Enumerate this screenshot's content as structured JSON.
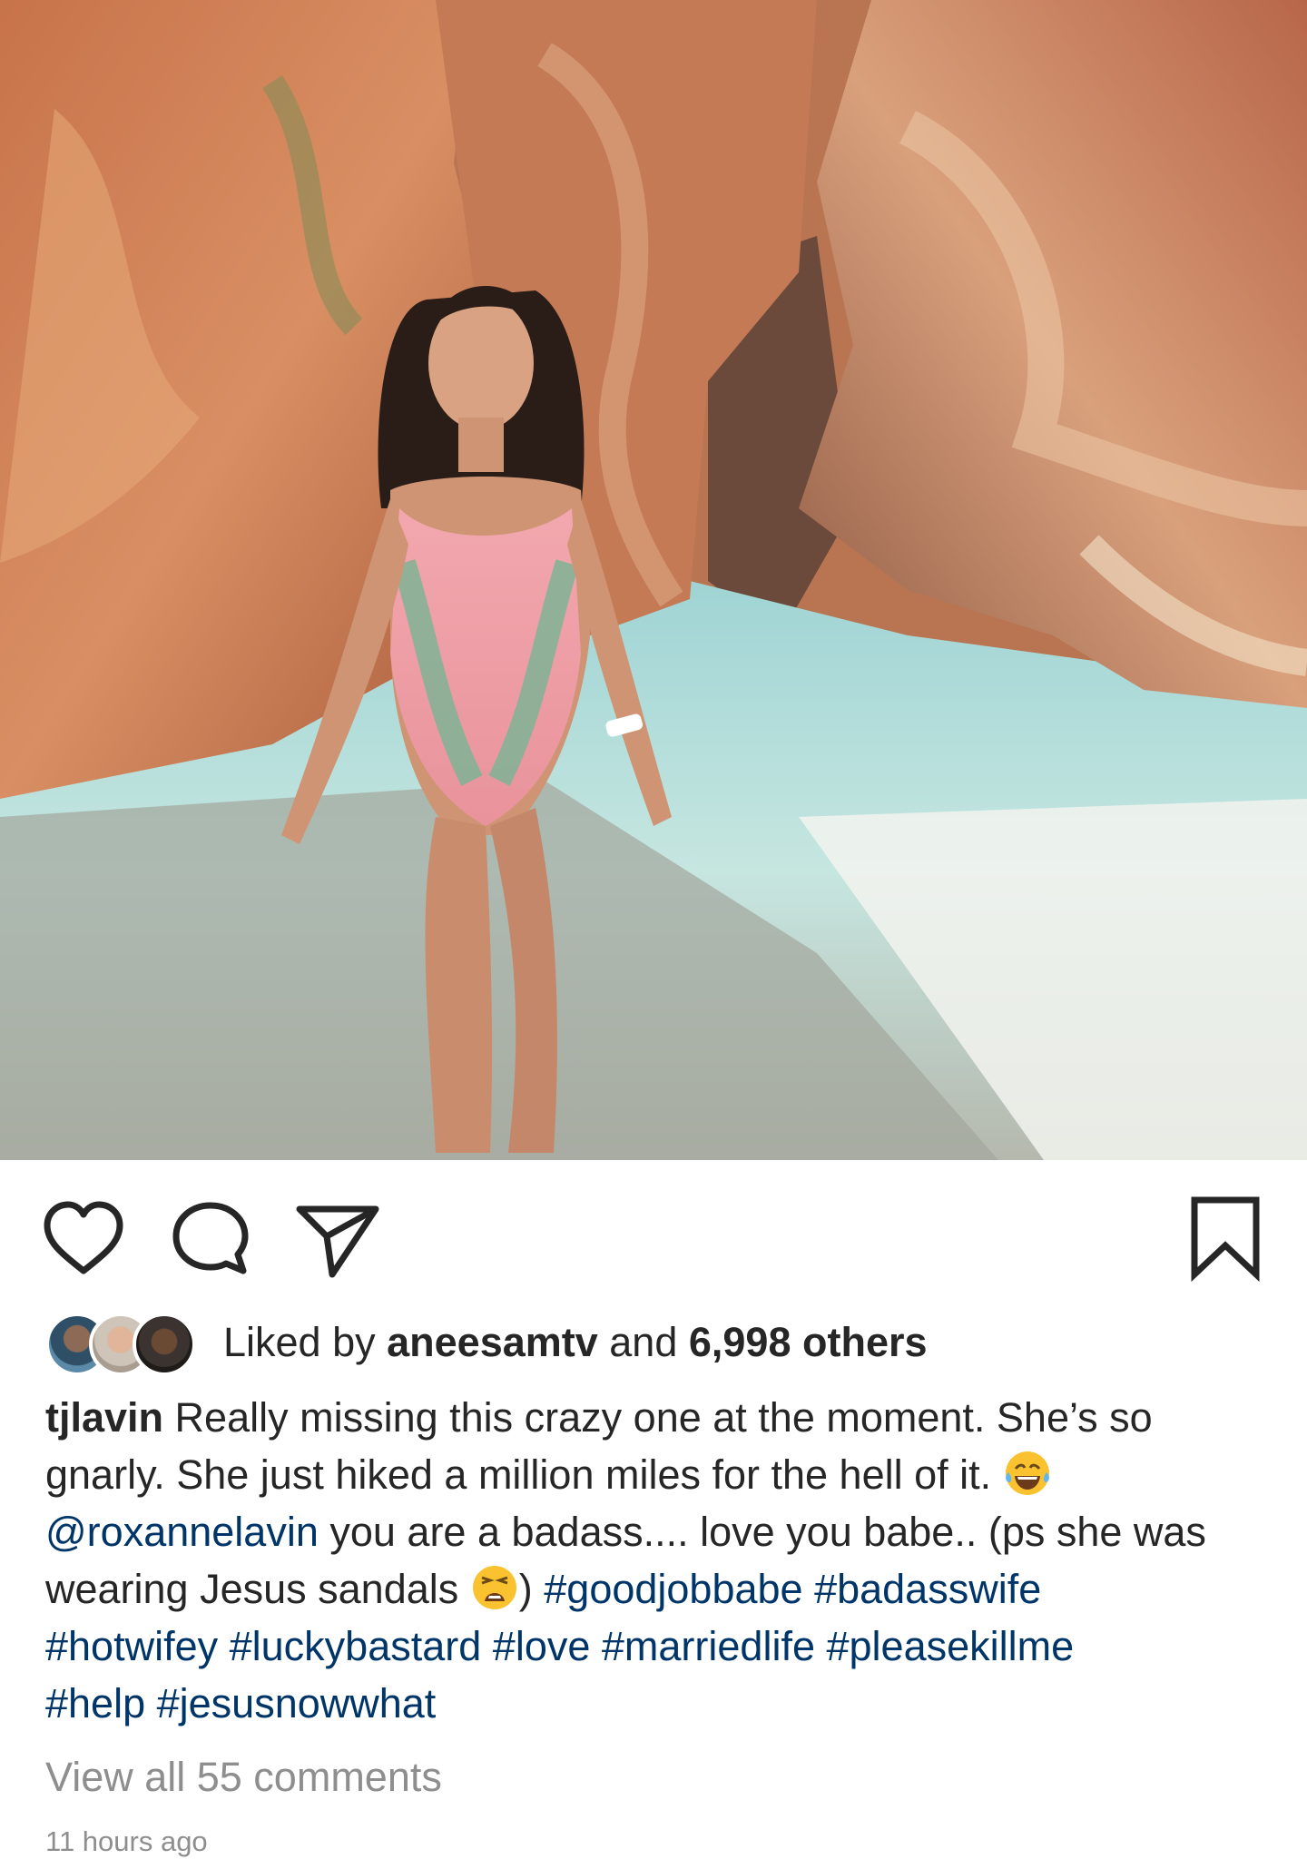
{
  "post": {
    "image_alt": "Woman in a pink one-piece swimsuit standing in turquoise water inside a red rock canyon",
    "actions": {
      "like_icon": "heart-outline-icon",
      "comment_icon": "comment-bubble-icon",
      "share_icon": "paper-plane-icon",
      "save_icon": "bookmark-outline-icon"
    },
    "likes": {
      "prefix": "Liked by ",
      "user": "aneesamtv",
      "middle": " and ",
      "count": "6,998 others"
    },
    "caption": {
      "username": "tjlavin",
      "text_1": " Really missing this crazy one at the moment. She’s so gnarly. She just hiked a million miles for the hell of it. ",
      "mention": "@roxannelavin",
      "text_2": " you are a badass.... love you babe.. (ps she was wearing Jesus sandals ",
      "text_3": ") ",
      "hashtags": [
        "#goodjobbabe",
        "#badasswife",
        "#hotwifey",
        "#luckybastard",
        "#love",
        "#marriedlife",
        "#pleasekillme",
        "#help",
        "#jesusnowwhat"
      ]
    },
    "view_comments": "View all 55 comments",
    "timestamp": "11 hours ago",
    "colors": {
      "text": "#262626",
      "link": "#003569",
      "muted": "#8e8e8e"
    }
  }
}
